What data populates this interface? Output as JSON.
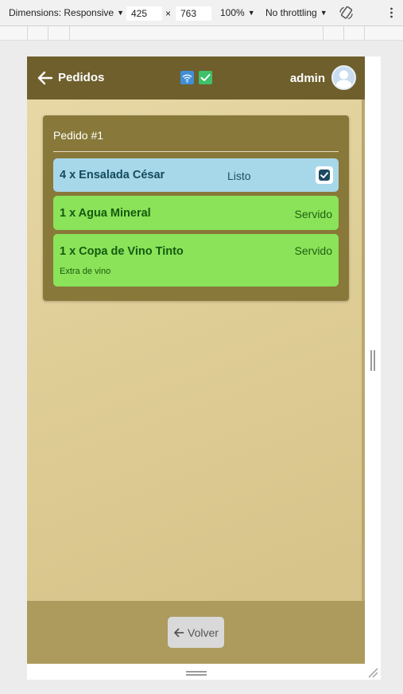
{
  "devtools": {
    "dimensions_label": "Dimensions: Responsive",
    "width_value": "425",
    "times": "×",
    "height_value": "763",
    "zoom": "100%",
    "throttling": "No throttling"
  },
  "app": {
    "header": {
      "title": "Pedidos",
      "user": "admin",
      "wifi_icon": "wifi-icon",
      "sync_icon": "check-icon"
    },
    "order": {
      "title": "Pedido #1",
      "items": [
        {
          "name": "4 x Ensalada César",
          "status": "Listo",
          "checked": true,
          "color": "#a7d8ea"
        },
        {
          "name": "1 x Agua Mineral",
          "status": "Servido",
          "color": "#8ae358"
        },
        {
          "name": "1 x Copa de Vino Tinto",
          "status": "Servido",
          "note": "Extra de vino",
          "color": "#8ae358"
        }
      ]
    },
    "footer": {
      "back_label": "Volver"
    },
    "colors": {
      "header": "#6e5f2c",
      "card": "#887839",
      "footer": "#ac9b5d"
    }
  }
}
